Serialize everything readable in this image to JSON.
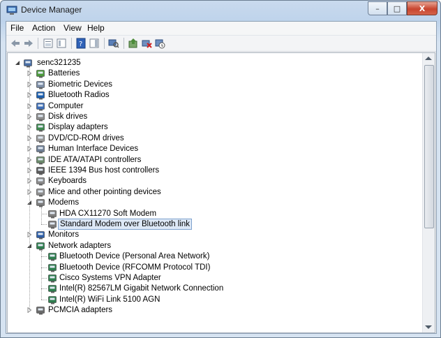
{
  "window": {
    "title": "Device Manager"
  },
  "caption": {
    "minimize": "–",
    "maximize": "□",
    "close": "X"
  },
  "menu": [
    "File",
    "Action",
    "View",
    "Help"
  ],
  "toolbar": [
    "back-icon",
    "forward-icon",
    "properties-pane-icon",
    "show-hide-tree-icon",
    "help-icon",
    "action-pane-icon",
    "scan-hardware-icon",
    "update-driver-icon",
    "uninstall-icon",
    "disable-icon"
  ],
  "tree": {
    "root": "senc321235",
    "items": [
      {
        "label": "Batteries",
        "icon": "battery-icon",
        "expanded": false
      },
      {
        "label": "Biometric Devices",
        "icon": "biometric-icon",
        "expanded": false
      },
      {
        "label": "Bluetooth Radios",
        "icon": "bluetooth-icon",
        "expanded": false
      },
      {
        "label": "Computer",
        "icon": "computer-icon",
        "expanded": false
      },
      {
        "label": "Disk drives",
        "icon": "disk-drive-icon",
        "expanded": false
      },
      {
        "label": "Display adapters",
        "icon": "display-adapter-icon",
        "expanded": false
      },
      {
        "label": "DVD/CD-ROM drives",
        "icon": "dvd-drive-icon",
        "expanded": false
      },
      {
        "label": "Human Interface Devices",
        "icon": "hid-icon",
        "expanded": false
      },
      {
        "label": "IDE ATA/ATAPI controllers",
        "icon": "ide-controller-icon",
        "expanded": false
      },
      {
        "label": "IEEE 1394 Bus host controllers",
        "icon": "ieee1394-icon",
        "expanded": false
      },
      {
        "label": "Keyboards",
        "icon": "keyboard-icon",
        "expanded": false
      },
      {
        "label": "Mice and other pointing devices",
        "icon": "mouse-icon",
        "expanded": false
      },
      {
        "label": "Modems",
        "icon": "modem-icon",
        "expanded": true,
        "children": [
          {
            "label": "HDA CX11270 Soft Modem",
            "icon": "modem-icon"
          },
          {
            "label": "Standard Modem over Bluetooth link",
            "icon": "modem-icon",
            "selected": true
          }
        ]
      },
      {
        "label": "Monitors",
        "icon": "monitor-icon",
        "expanded": false
      },
      {
        "label": "Network adapters",
        "icon": "network-adapter-icon",
        "expanded": true,
        "children": [
          {
            "label": "Bluetooth Device (Personal Area Network)",
            "icon": "network-adapter-icon"
          },
          {
            "label": "Bluetooth Device (RFCOMM Protocol TDI)",
            "icon": "network-adapter-icon"
          },
          {
            "label": "Cisco Systems VPN Adapter",
            "icon": "network-adapter-icon"
          },
          {
            "label": "Intel(R) 82567LM Gigabit Network Connection",
            "icon": "network-adapter-icon"
          },
          {
            "label": "Intel(R) WiFi Link 5100 AGN",
            "icon": "network-adapter-icon"
          }
        ]
      },
      {
        "label": "PCMCIA adapters",
        "icon": "pcmcia-icon",
        "expanded": false
      }
    ]
  }
}
